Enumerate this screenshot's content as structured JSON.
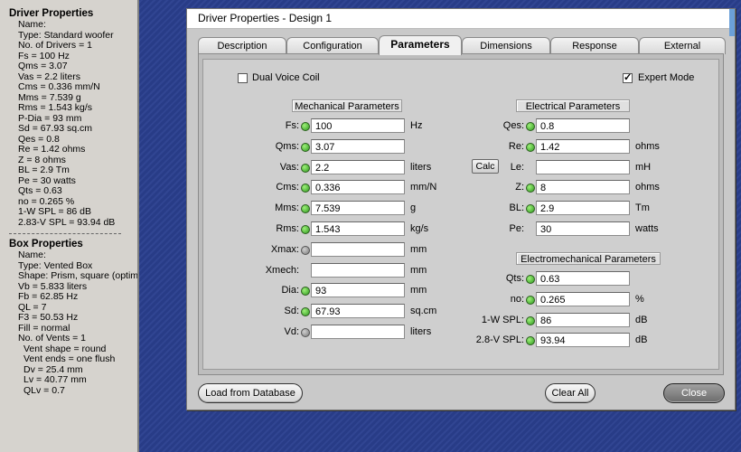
{
  "left_panel": {
    "driver_title": "Driver Properties",
    "driver_lines": [
      "Name:",
      "Type: Standard woofer",
      "No. of Drivers = 1",
      "Fs = 100 Hz",
      "Qms = 3.07",
      "Vas = 2.2 liters",
      "Cms = 0.336 mm/N",
      "Mms = 7.539 g",
      "Rms = 1.543 kg/s",
      "P-Dia = 93 mm",
      "Sd = 67.93 sq.cm",
      "Qes = 0.8",
      "Re = 1.42 ohms",
      "Z = 8 ohms",
      "BL = 2.9 Tm",
      "Pe = 30 watts",
      "Qts = 0.63",
      "no = 0.265 %",
      "1-W SPL = 86 dB",
      "2.83-V SPL = 93.94 dB"
    ],
    "box_title": "Box Properties",
    "box_lines": [
      "Name:",
      "Type: Vented Box",
      "Shape: Prism, square (optimu",
      "Vb = 5.833 liters",
      "Fb = 62.85 Hz",
      "QL = 7",
      "F3 = 50.53 Hz",
      "Fill = normal",
      "No. of Vents = 1"
    ],
    "vent_lines": [
      "Vent shape = round",
      "Vent ends = one flush",
      "Dv = 25.4 mm",
      "Lv = 40.77 mm",
      "QLv = 0.7"
    ]
  },
  "dialog": {
    "title": "Driver Properties - Design 1",
    "tabs": [
      "Description",
      "Configuration",
      "Parameters",
      "Dimensions",
      "Response",
      "External"
    ],
    "active_tab": "Parameters",
    "dual_voice_coil": {
      "label": "Dual Voice Coil",
      "checked": false
    },
    "expert_mode": {
      "label": "Expert Mode",
      "checked": true
    },
    "mechanical_header": "Mechanical Parameters",
    "electrical_header": "Electrical Parameters",
    "electromechanical_header": "Electromechanical Parameters",
    "calc_label": "Calc",
    "mechanical": [
      {
        "label": "Fs:",
        "value": "100",
        "unit": "Hz",
        "status": "green"
      },
      {
        "label": "Qms:",
        "value": "3.07",
        "unit": "",
        "status": "green"
      },
      {
        "label": "Vas:",
        "value": "2.2",
        "unit": "liters",
        "status": "green"
      },
      {
        "label": "Cms:",
        "value": "0.336",
        "unit": "mm/N",
        "status": "green"
      },
      {
        "label": "Mms:",
        "value": "7.539",
        "unit": "g",
        "status": "green"
      },
      {
        "label": "Rms:",
        "value": "1.543",
        "unit": "kg/s",
        "status": "green"
      },
      {
        "label": "Xmax:",
        "value": "",
        "unit": "mm",
        "status": "gray"
      },
      {
        "label": "Xmech:",
        "value": "",
        "unit": "mm",
        "status": "none"
      },
      {
        "label": "Dia:",
        "value": "93",
        "unit": "mm",
        "status": "green"
      },
      {
        "label": "Sd:",
        "value": "67.93",
        "unit": "sq.cm",
        "status": "green"
      },
      {
        "label": "Vd:",
        "value": "",
        "unit": "liters",
        "status": "gray"
      }
    ],
    "electrical": [
      {
        "label": "Qes:",
        "value": "0.8",
        "unit": "",
        "status": "green"
      },
      {
        "label": "Re:",
        "value": "1.42",
        "unit": "ohms",
        "status": "green"
      },
      {
        "label": "Le:",
        "value": "",
        "unit": "mH",
        "status": "none"
      },
      {
        "label": "Z:",
        "value": "8",
        "unit": "ohms",
        "status": "green"
      },
      {
        "label": "BL:",
        "value": "2.9",
        "unit": "Tm",
        "status": "green"
      },
      {
        "label": "Pe:",
        "value": "30",
        "unit": "watts",
        "status": "none"
      }
    ],
    "electromechanical": [
      {
        "label": "Qts:",
        "value": "0.63",
        "unit": "",
        "status": "green"
      },
      {
        "label": "no:",
        "value": "0.265",
        "unit": "%",
        "status": "green"
      },
      {
        "label": "1-W SPL:",
        "value": "86",
        "unit": "dB",
        "status": "green"
      },
      {
        "label": "2.8-V SPL:",
        "value": "93.94",
        "unit": "dB",
        "status": "green"
      }
    ],
    "buttons": {
      "load": "Load from Database",
      "clear": "Clear All",
      "close": "Close"
    }
  },
  "colors": {
    "desktop": "#2a3f8e",
    "panel": "#d6d3ce",
    "dialog": "#c9c9c9",
    "indicator_green": "#2f9a1f",
    "indicator_gray": "#7a7a7a"
  },
  "icons": {
    "title_icon": "app-icon",
    "indicator": "status-led-icon",
    "checkmark": "checkmark-icon"
  }
}
